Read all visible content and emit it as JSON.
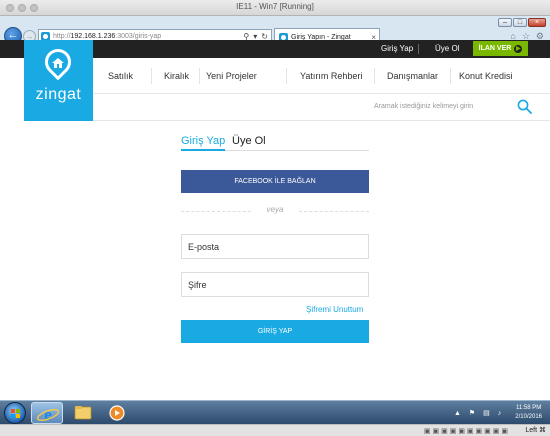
{
  "vm_window": {
    "title": "IE11 - Win7 [Running]",
    "status_key": "Left ⌘"
  },
  "browser": {
    "url_prefix": "http://",
    "url_host": "192.168.1.236",
    "url_path": ":3003/giris-yap",
    "tab_title": "Giriş Yapın - Zingat",
    "tab_close": "×",
    "controls": {
      "minimize": "–",
      "maximize": "□",
      "close": "×"
    }
  },
  "site": {
    "logo_text": "zingat",
    "top_links": {
      "login": "Giriş Yap",
      "register": "Üye Ol",
      "post_ad": "İLAN VER"
    },
    "nav": [
      "Satılık",
      "Kiralık",
      "Yeni Projeler",
      "Yatırım Rehberi",
      "Danışmanlar",
      "Konut Kredisi"
    ],
    "search": {
      "placeholder": "Aramak istediğiniz kelimeyi girin"
    },
    "colors": {
      "brand": "#19a9e3",
      "topbar": "#222222",
      "ad_button": "#7ab800",
      "facebook": "#3b5998"
    }
  },
  "login_form": {
    "tab_login": "Giriş Yap",
    "tab_register": "Üye Ol",
    "facebook_button": "FACEBOOK İLE BAĞLAN",
    "divider_text": "veya",
    "email_label": "E-posta",
    "password_label": "Şifre",
    "forgot_password": "Şifremi Unuttum",
    "submit_button": "GİRİŞ YAP"
  },
  "taskbar": {
    "time": "11:58 PM",
    "date": "2/10/2016",
    "apps": [
      "internet-explorer-icon",
      "folder-icon",
      "media-player-icon"
    ]
  }
}
